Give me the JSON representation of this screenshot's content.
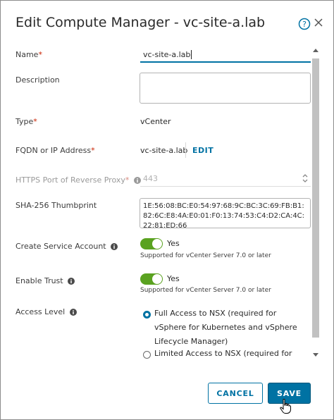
{
  "dialog": {
    "title": "Edit Compute Manager - vc-site-a.lab"
  },
  "form": {
    "name": {
      "label": "Name",
      "required_mark": "*",
      "value": "vc-site-a.lab"
    },
    "description": {
      "label": "Description",
      "value": ""
    },
    "type": {
      "label": "Type",
      "required_mark": "*",
      "value": "vCenter"
    },
    "fqdn": {
      "label": "FQDN or IP Address",
      "required_mark": "*",
      "value": "vc-site-a.lab",
      "edit_label": "EDIT"
    },
    "https_port": {
      "label": "HTTPS Port of Reverse Proxy",
      "required_mark": "*",
      "placeholder": "443"
    },
    "thumbprint": {
      "label": "SHA-256 Thumbprint",
      "value": "1E:56:08:BC:E0:54:97:68:9C:BC:3C:69:FB:B1:82:6C:E8:4A:E0:01:F0:13:74:53:C4:D2:CA:4C:22:81:ED:66"
    },
    "service_account": {
      "label": "Create Service Account",
      "toggle_label": "Yes",
      "helper": "Supported for vCenter Server 7.0 or later",
      "enabled": true
    },
    "enable_trust": {
      "label": "Enable Trust",
      "toggle_label": "Yes",
      "helper": "Supported for vCenter Server 7.0 or later",
      "enabled": true
    },
    "access_level": {
      "label": "Access Level",
      "options": [
        {
          "label": "Full Access to NSX (required for vSphere for Kubernetes and vSphere Lifecycle Manager)",
          "selected": true
        },
        {
          "label": "Limited Access to NSX (required for",
          "selected": false
        }
      ]
    }
  },
  "footer": {
    "cancel_label": "CANCEL",
    "save_label": "SAVE"
  },
  "colors": {
    "accent": "#0072a3",
    "toggle_on": "#5aa220",
    "required": "#c92100"
  }
}
